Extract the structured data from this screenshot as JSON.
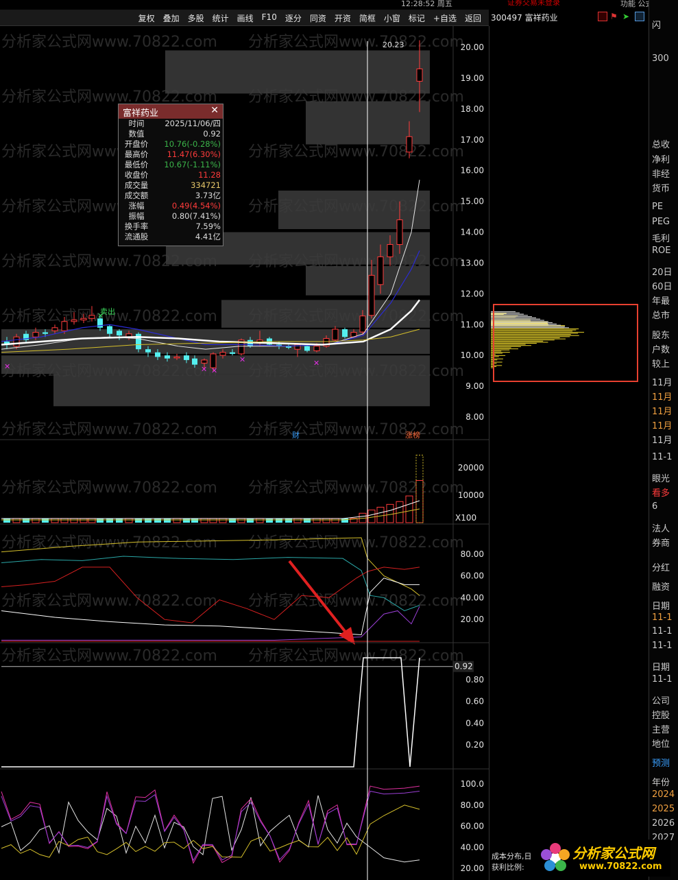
{
  "top": {
    "clock": "12:28:52 周五",
    "red_text": "证券交易未登录",
    "right_text": "功能  公式"
  },
  "toolbar": {
    "buttons": [
      "复权",
      "叠加",
      "多股",
      "统计",
      "画线",
      "F10",
      "逐分",
      "同资",
      "开资",
      "简框",
      "小窗",
      "标记",
      "+自选",
      "返回"
    ]
  },
  "stock": {
    "title": "300497 富祥药业"
  },
  "tooltip": {
    "name": "富祥药业",
    "rows": [
      {
        "k": "时间",
        "v": "2025/11/06/四",
        "c": "#dddddd"
      },
      {
        "k": "数值",
        "v": "0.92",
        "c": "#dddddd"
      },
      {
        "k": "开盘价",
        "v": "10.76(-0.28%)",
        "c": "#3bb54a"
      },
      {
        "k": "最高价",
        "v": "11.47(6.30%)",
        "c": "#ff3b3b"
      },
      {
        "k": "最低价",
        "v": "10.67(-1.11%)",
        "c": "#3bb54a"
      },
      {
        "k": "收盘价",
        "v": "11.28",
        "c": "#ff3b3b"
      },
      {
        "k": "成交量",
        "v": "334721",
        "c": "#e8c86a"
      },
      {
        "k": "成交额",
        "v": "3.73亿",
        "c": "#dddddd"
      },
      {
        "k": "涨幅",
        "v": "0.49(4.54%)",
        "c": "#ff3b3b"
      },
      {
        "k": "振幅",
        "v": "0.80(7.41%)",
        "c": "#dddddd"
      },
      {
        "k": "换手率",
        "v": "7.59%",
        "c": "#dddddd"
      },
      {
        "k": "流通股",
        "v": "4.41亿",
        "c": "#dddddd"
      }
    ]
  },
  "price_axis": [
    "20.00",
    "19.00",
    "18.00",
    "17.00",
    "16.00",
    "15.00",
    "14.00",
    "13.00",
    "12.00",
    "11.00",
    "10.00",
    "9.00",
    "8.00"
  ],
  "price_high_label": "20.23",
  "markers": {
    "sell": "卖出",
    "fin": "财",
    "limit": "涨榜"
  },
  "volume_axis": [
    "20000",
    "10000"
  ],
  "volume_unit": "X100",
  "ind1_axis": [
    "80.00",
    "60.00",
    "40.00",
    "20.00"
  ],
  "ind2_axis": [
    "0.80",
    "0.60",
    "0.40",
    "0.20"
  ],
  "ind2_value": "0.92",
  "ind3_axis": [
    "100.0",
    "80.00",
    "60.00",
    "40.00",
    "20.00"
  ],
  "watermark": "分析家公式网www.70822.com",
  "cost_label": "成本分布,日",
  "profit_label": "获利比例:",
  "logo": {
    "name": "分析家公式网",
    "url": "www.70822.com"
  },
  "far_right": {
    "labels": [
      "闪",
      "300",
      "总收",
      "净利",
      "非经",
      "货币",
      "PE",
      "PEG",
      "毛利",
      "ROE",
      "20日",
      "60日",
      "年最",
      "总市",
      "股东",
      "户数",
      "较上",
      "11月",
      "11月",
      "11月",
      "11月",
      "11月",
      "11-1",
      "眼光",
      "看多",
      "6",
      "法人",
      "券商",
      "分红",
      "融资",
      "日期",
      "11-1",
      "11-1",
      "11-1",
      "日期",
      "11-1",
      "公司",
      "控股",
      "主营",
      "地位",
      "预测",
      "年份",
      "2024",
      "2025",
      "2026",
      "2027"
    ]
  },
  "colors": {
    "up": "#ff3b3b",
    "down": "#54f0f0",
    "ma_white": "#ffffff",
    "ma_blue": "#2b2bd6",
    "ma_yellow": "#d6c02b",
    "box": "#3c3c3c",
    "chip": "#e8d22a",
    "chip_box": "#e84030"
  }
}
